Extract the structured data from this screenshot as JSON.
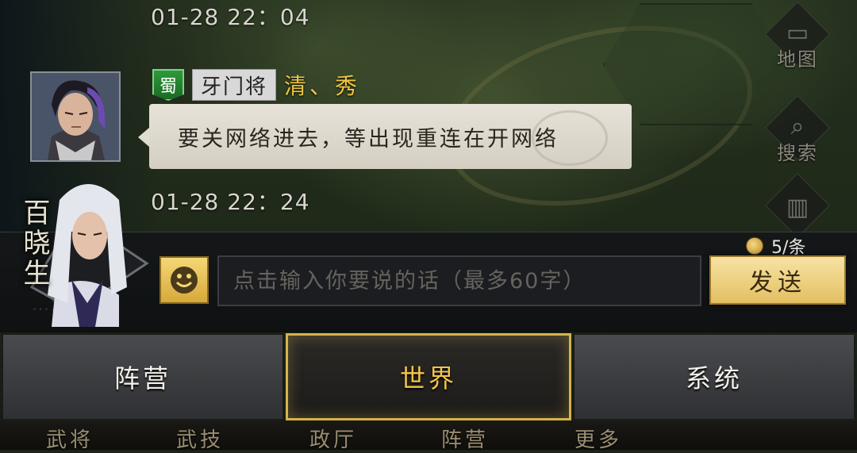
{
  "map_buttons": [
    {
      "label": "地图",
      "icon": "scroll-map-icon"
    },
    {
      "label": "搜索",
      "icon": "magnifier-icon"
    }
  ],
  "messages": [
    {
      "time": "01-28 22：04"
    },
    {
      "faction": "蜀",
      "rank": "牙门将",
      "name": "清、秀",
      "text": "要关网络进去，等出现重连在开网络",
      "time": "01-28 22：24"
    }
  ],
  "npc": {
    "name": "百晓生"
  },
  "input": {
    "placeholder": "点击输入你要说的话（最多60字）",
    "cost": "5/条",
    "send_label": "发送",
    "ghost_text": "…济门…"
  },
  "tabs": [
    {
      "label": "阵营",
      "active": false
    },
    {
      "label": "世界",
      "active": true
    },
    {
      "label": "系统",
      "active": false
    }
  ],
  "bottom_nav": [
    "武将",
    "武技",
    "政厅",
    "阵营",
    "更多"
  ],
  "colors": {
    "accent_gold": "#f0c640",
    "active_tab_border": "#d6b34a",
    "faction_green": "#2e9a3a",
    "send_button": "#e3bf61"
  }
}
